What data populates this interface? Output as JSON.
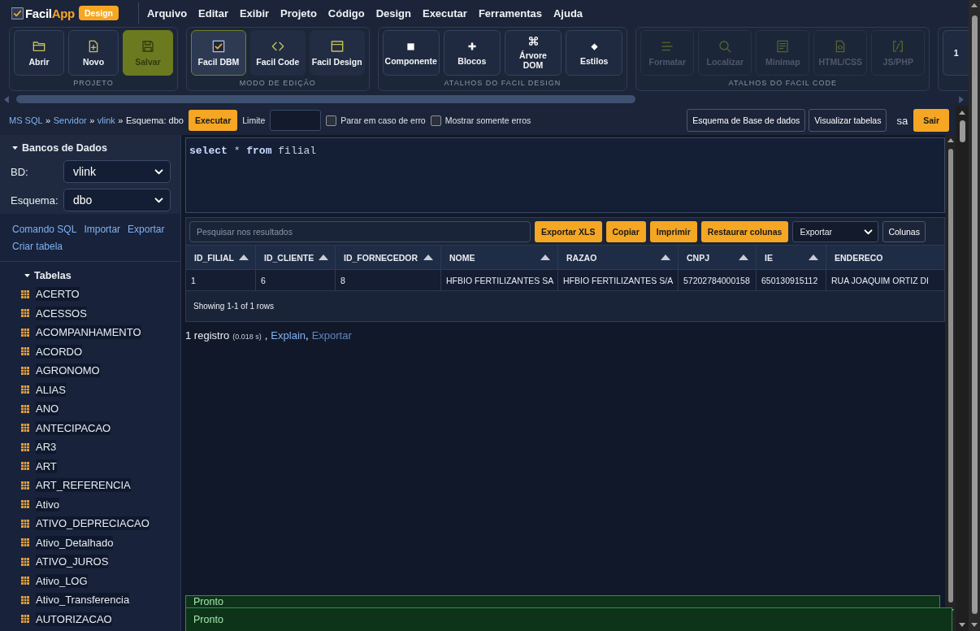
{
  "header": {
    "brand": {
      "name": "Facil",
      "accent": "App"
    },
    "badge": "Design",
    "menu": [
      "Arquivo",
      "Editar",
      "Exibir",
      "Projeto",
      "Código",
      "Design",
      "Executar",
      "Ferramentas",
      "Ajuda"
    ]
  },
  "ribbon": {
    "groups": [
      {
        "label": "PROJETO",
        "buttons": [
          {
            "label": "Abrir",
            "highlighted": false
          },
          {
            "label": "Novo",
            "highlighted": false
          },
          {
            "label": "Salvar",
            "highlighted": true
          }
        ]
      },
      {
        "label": "MODO DE EDIÇÃO",
        "buttons": [
          {
            "label": "Facil DBM",
            "selected": true
          },
          {
            "label": "Facil Code",
            "selected": false
          },
          {
            "label": "Facil Design",
            "selected": false
          }
        ]
      },
      {
        "label": "ATALHOS DO FACIL DESIGN",
        "buttons": [
          {
            "label": "Componente",
            "disabled": false
          },
          {
            "label": "Blocos",
            "disabled": false
          },
          {
            "label": "Árvore\nDOM",
            "disabled": false
          },
          {
            "label": "Estilos",
            "disabled": false
          }
        ]
      },
      {
        "label": "ATALHOS DO FACIL CODE",
        "buttons": [
          {
            "label": "Formatar",
            "disabled": true
          },
          {
            "label": "Localizar",
            "disabled": true
          },
          {
            "label": "Minimap",
            "disabled": true
          },
          {
            "label": "HTML/CSS",
            "disabled": true
          },
          {
            "label": "JS/PHP",
            "disabled": true
          }
        ]
      },
      {
        "buttons": [
          {
            "label": "1",
            "disabled": false
          }
        ]
      }
    ]
  },
  "toolbar": {
    "breadcrumb": [
      {
        "kind": "link",
        "text": "MS SQL"
      },
      {
        "kind": "separator",
        "text": "»"
      },
      {
        "kind": "link",
        "text": "Servidor"
      },
      {
        "kind": "separator",
        "text": "»"
      },
      {
        "kind": "link",
        "text": "vlink"
      },
      {
        "kind": "separator",
        "text": "»"
      },
      {
        "kind": "text",
        "text": "Esquema: dbo"
      }
    ],
    "run_button": "Executar",
    "limit_label": "Limite",
    "options": [
      {
        "label": "Parar em caso de erro",
        "checked": false
      },
      {
        "label": "Mostrar somente erros",
        "checked": false
      }
    ],
    "buttons": [
      "Esquema de Base de dados",
      "Visualizar tabelas"
    ],
    "user": "sa",
    "logout_button": "Sair"
  },
  "sidebar": {
    "databases": {
      "title": "Bancos de Dados",
      "expanded": true,
      "fields": [
        {
          "label": "BD:",
          "value": "vlink"
        },
        {
          "label": "Esquema:",
          "value": "dbo"
        }
      ]
    },
    "links": [
      "Comando SQL",
      "Importar",
      "Exportar",
      "Criar tabela"
    ],
    "tree": {
      "label": "Tabelas",
      "expanded": true,
      "children": [
        {
          "label": "ACERTO"
        },
        {
          "label": "ACESSOS"
        },
        {
          "label": "ACOMPANHAMENTO"
        },
        {
          "label": "ACORDO"
        },
        {
          "label": "AGRONOMO"
        },
        {
          "label": "ALIAS"
        },
        {
          "label": "ANO"
        },
        {
          "label": "ANTECIPACAO"
        },
        {
          "label": "AR3"
        },
        {
          "label": "ART"
        },
        {
          "label": "ART_REFERENCIA"
        },
        {
          "label": "Ativo"
        },
        {
          "label": "ATIVO_DEPRECIACAO"
        },
        {
          "label": "Ativo_Detalhado"
        },
        {
          "label": "ATIVO_JUROS"
        },
        {
          "label": "Ativo_LOG"
        },
        {
          "label": "Ativo_Transferencia"
        },
        {
          "label": "AUTORIZACAO"
        }
      ]
    }
  },
  "editor": {
    "tokens": [
      {
        "kind": "keyword",
        "text": "select"
      },
      {
        "kind": "plain",
        "text": "*"
      },
      {
        "kind": "keyword",
        "text": "from"
      },
      {
        "kind": "plain",
        "text": "filial"
      }
    ]
  },
  "results": {
    "search": {
      "placeholder": "Pesquisar nos resultados"
    },
    "actions": [
      "Exportar XLS",
      "Copiar",
      "Imprimir",
      "Restaurar colunas"
    ],
    "export_select": "Exportar",
    "columns_button": "Colunas",
    "table": {
      "columns": [
        {
          "label": "ID_FILIAL",
          "sortable": true
        },
        {
          "label": "ID_CLIENTE",
          "sortable": true
        },
        {
          "label": "ID_FORNECEDOR",
          "sortable": true
        },
        {
          "label": "NOME",
          "sortable": true
        },
        {
          "label": "RAZAO",
          "sortable": true
        },
        {
          "label": "CNPJ",
          "sortable": true
        },
        {
          "label": "IE",
          "sortable": true
        },
        {
          "label": "ENDERECO",
          "sortable": false
        }
      ],
      "rows": [
        [
          "1",
          "6",
          "8",
          "HFBIO FERTILIZANTES SA",
          "HFBIO FERTILIZANTES S/A",
          "57202784000158",
          "650130915112",
          "RUA JOAQUIM ORTIZ DI"
        ]
      ]
    },
    "footer": "Showing 1-1 of 1 rows"
  },
  "summary": [
    {
      "kind": "text",
      "text": "1 registro"
    },
    {
      "kind": "small",
      "text": "(0.018 s)"
    },
    {
      "kind": "text",
      "text": ","
    },
    {
      "kind": "link",
      "text": "Explain",
      "visited": false
    },
    {
      "kind": "text",
      "text": ","
    },
    {
      "kind": "link",
      "text": "Exportar",
      "visited": true
    }
  ],
  "notifications": [
    "Pronto",
    "Pronto"
  ]
}
